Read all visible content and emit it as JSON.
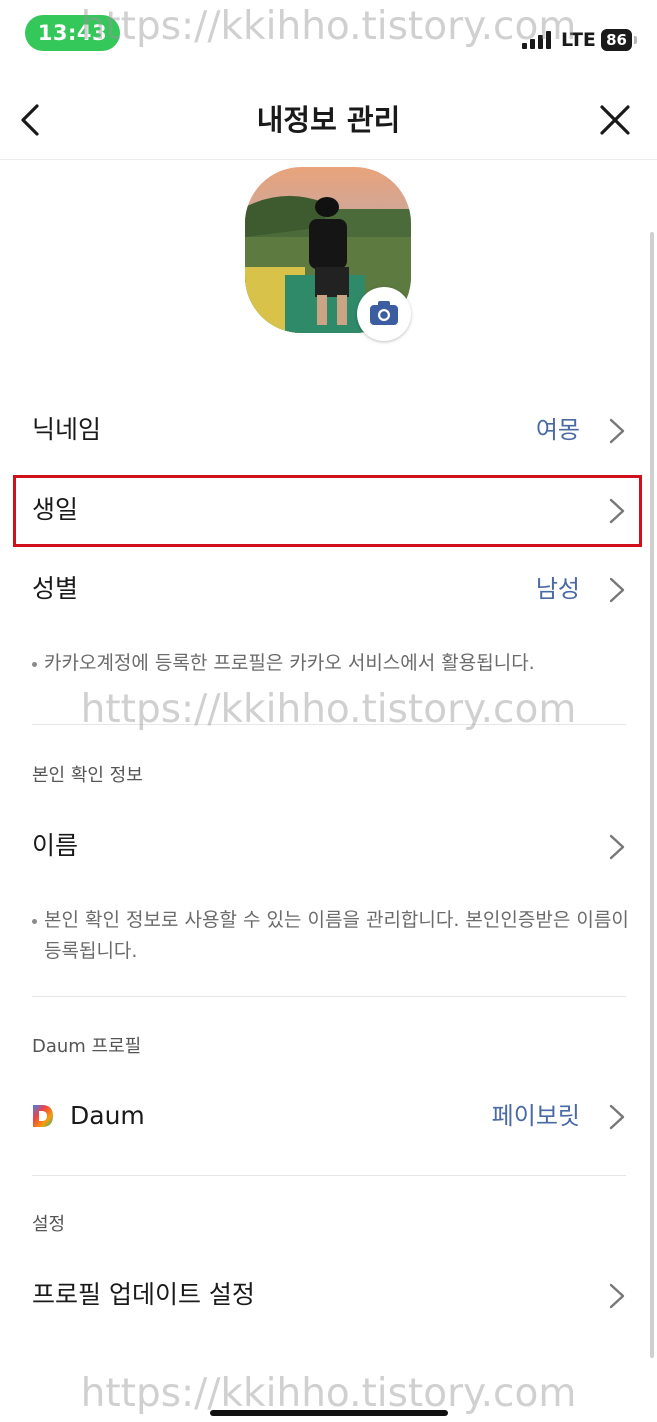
{
  "status_bar": {
    "time": "13:43",
    "network": "LTE",
    "battery": "86"
  },
  "header": {
    "title": "내정보 관리",
    "back_icon": "chevron-left-icon",
    "close_icon": "close-icon"
  },
  "profile": {
    "avatar_icon": "profile-photo",
    "camera_icon": "camera-icon"
  },
  "rows": [
    {
      "label": "닉네임",
      "value": "여몽"
    },
    {
      "label": "생일",
      "value": ""
    },
    {
      "label": "성별",
      "value": "남성"
    }
  ],
  "profile_note": "카카오계정에 등록한 프로필은 카카오 서비스에서 활용됩니다.",
  "identity": {
    "section_title": "본인 확인 정보",
    "name_label": "이름",
    "note": "본인 확인 정보로 사용할 수 있는 이름을 관리합니다. 본인인증받은 이름이 등록됩니다."
  },
  "daum": {
    "section_title": "Daum 프로필",
    "label": "Daum",
    "value": "페이보릿"
  },
  "settings": {
    "section_title": "설정",
    "update_label": "프로필 업데이트 설정"
  },
  "watermark": "https://kkihho.tistory.com",
  "colors": {
    "accent_value": "#4a6aa5",
    "highlight_border": "#d0101b",
    "time_pill": "#34c759"
  }
}
